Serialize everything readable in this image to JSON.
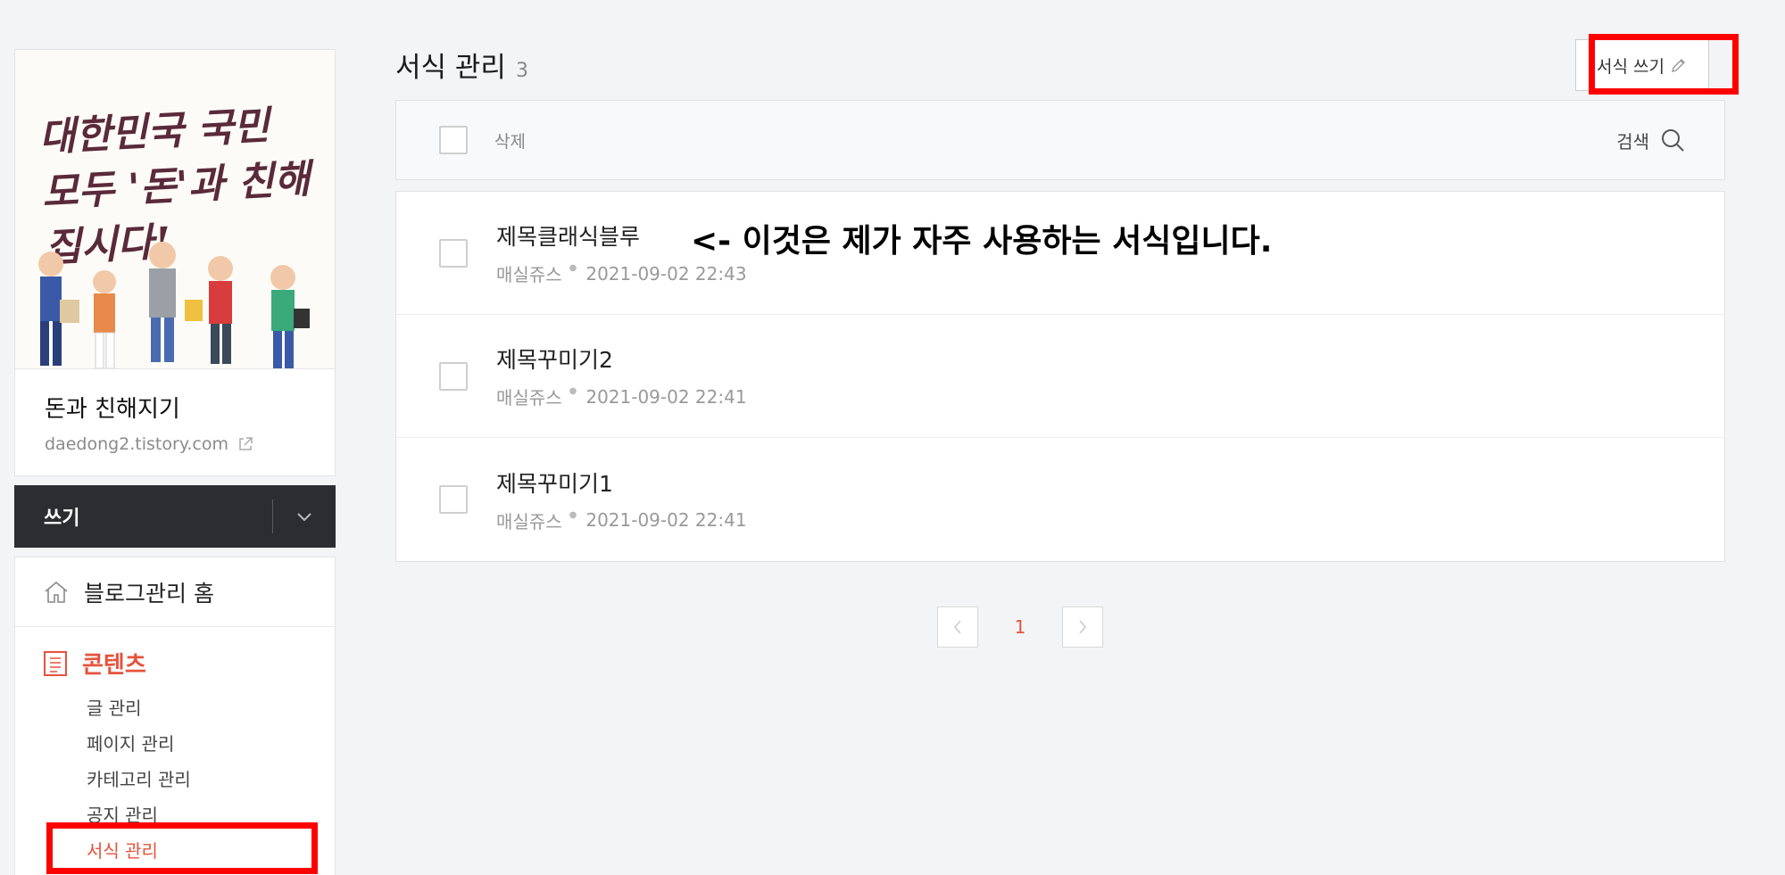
{
  "blog": {
    "cover_text": "대한민국 국민 모두 '돈'과 친해집시다!",
    "name": "돈과 친해지기",
    "url": "daedong2.tistory.com"
  },
  "sidebar": {
    "write_label": "쓰기",
    "home_label": "블로그관리 홈",
    "section_label": "콘텐츠",
    "submenu": [
      "글 관리",
      "페이지 관리",
      "카테고리 관리",
      "공지 관리",
      "서식 관리"
    ]
  },
  "main": {
    "title": "서식 관리",
    "count": "3",
    "write_form_label": "서식 쓰기",
    "delete_label": "삭제",
    "search_label": "검색",
    "annotation": "<- 이것은 제가 자주 사용하는 서식입니다.",
    "rows": [
      {
        "title": "제목클래식블루",
        "author": "매실쥬스",
        "date": "2021-09-02 22:43"
      },
      {
        "title": "제목꾸미기2",
        "author": "매실쥬스",
        "date": "2021-09-02 22:41"
      },
      {
        "title": "제목꾸미기1",
        "author": "매실쥬스",
        "date": "2021-09-02 22:41"
      }
    ],
    "current_page": "1"
  },
  "colors": {
    "accent": "#e5533c",
    "highlight_box": "#ff0000",
    "write_bar": "#2b2d31"
  }
}
